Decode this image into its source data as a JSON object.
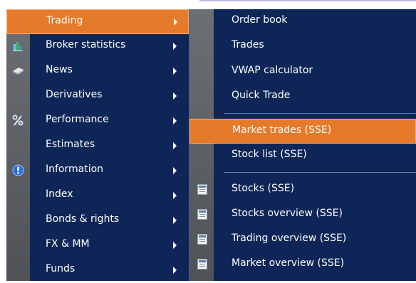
{
  "main_menu": {
    "items": [
      {
        "label": "Trading",
        "icon": null,
        "highlighted": true
      },
      {
        "label": "Broker statistics",
        "icon": "bar-chart-icon",
        "highlighted": false
      },
      {
        "label": "News",
        "icon": "news-icon",
        "highlighted": false
      },
      {
        "label": "Derivatives",
        "icon": null,
        "highlighted": false
      },
      {
        "label": "Performance",
        "icon": "percent-icon",
        "highlighted": false
      },
      {
        "label": "Estimates",
        "icon": null,
        "highlighted": false
      },
      {
        "label": "Information",
        "icon": "info-icon",
        "highlighted": false
      },
      {
        "label": "Index",
        "icon": null,
        "highlighted": false
      },
      {
        "label": "Bonds & rights",
        "icon": null,
        "highlighted": false
      },
      {
        "label": "FX & MM",
        "icon": null,
        "highlighted": false
      },
      {
        "label": "Funds",
        "icon": null,
        "highlighted": false
      }
    ]
  },
  "sub_menu": {
    "items": [
      {
        "label": "Order book",
        "icon": null,
        "highlighted": false
      },
      {
        "label": "Trades",
        "icon": null,
        "highlighted": false
      },
      {
        "label": "VWAP calculator",
        "icon": null,
        "highlighted": false
      },
      {
        "label": "Quick Trade",
        "icon": null,
        "highlighted": false
      },
      {
        "label": "Market trades (SSE)",
        "icon": null,
        "highlighted": true
      },
      {
        "label": "Stock list (SSE)",
        "icon": null,
        "highlighted": false
      },
      {
        "label": "Stocks (SSE)",
        "icon": "window-icon",
        "highlighted": false
      },
      {
        "label": "Stocks overview (SSE)",
        "icon": "window-icon",
        "highlighted": false
      },
      {
        "label": "Trading overview (SSE)",
        "icon": "window-icon",
        "highlighted": false
      },
      {
        "label": "Market overview (SSE)",
        "icon": "window-icon",
        "highlighted": false
      }
    ]
  },
  "colors": {
    "menu_bg": "#0d2657",
    "highlight": "#e57a2b",
    "gutter": "#5f6266",
    "text": "#ffffff"
  }
}
